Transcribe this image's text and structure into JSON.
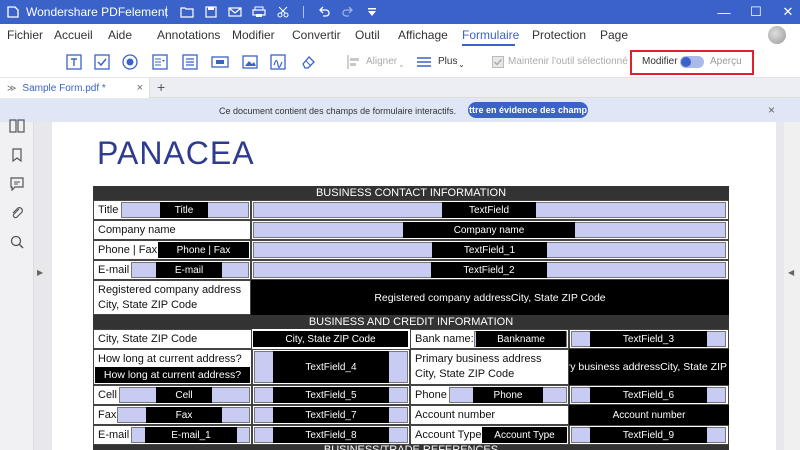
{
  "app": {
    "title": "Wondershare PDFelement"
  },
  "menu": [
    "Fichier",
    "Accueil",
    "Aide",
    "Annotations",
    "Modifier",
    "Convertir",
    "Outil",
    "Affichage",
    "Formulaire",
    "Protection",
    "Page"
  ],
  "active_menu": "Formulaire",
  "toolbar": {
    "aligner": "Aligner",
    "plus": "Plus",
    "keep_tool": "Maintenir l'outil sélectionné",
    "mode_edit": "Modifier",
    "mode_preview": "Aperçu"
  },
  "tab": {
    "name": "Sample Form.pdf *",
    "add": "+"
  },
  "notification": {
    "message": "Ce document contient des champs de formulaire interactifs.",
    "button": "ttre en évidence des champ",
    "close": "×"
  },
  "doc": {
    "brand": "PANACEA",
    "section1": "BUSINESS CONTACT INFORMATION",
    "section2": "BUSINESS AND CREDIT INFORMATION",
    "section3": "BUSINESS/TRADE REFERENCES",
    "labels": {
      "title": "Title",
      "company": "Company name",
      "phone_fax": "Phone | Fax",
      "email": "E-mail",
      "reg_addr_1": "Registered company address",
      "reg_addr_2": "City, State ZIP Code",
      "city": "City, State ZIP Code",
      "bank": "Bank name:",
      "how_long": "How long at current address?",
      "primary_1": "Primary business address",
      "primary_2": "City, State ZIP Code",
      "cell": "Cell",
      "phone": "Phone",
      "fax": "Fax",
      "account_number": "Account number",
      "email2": "E-mail",
      "account_type": "Account Type"
    },
    "fields": {
      "title": "Title",
      "textfield": "TextField",
      "company_name": "Company name",
      "phone_fax": "Phone | Fax",
      "textfield_1": "TextField_1",
      "email": "E-mail",
      "textfield_2": "TextField_2",
      "reg_addr": "Registered company addressCity, State ZIP Code",
      "city": "City, State ZIP Code",
      "bankname": "Bankname",
      "textfield_3": "TextField_3",
      "how_long": "How long at current address?",
      "textfield_4": "TextField_4",
      "primary_addr": "ry business addressCity, State ZIP",
      "cell": "Cell",
      "textfield_5": "TextField_5",
      "phone": "Phone",
      "textfield_6": "TextField_6",
      "fax": "Fax",
      "textfield_7": "TextField_7",
      "account_number": "Account number",
      "email_1": "E-mail_1",
      "textfield_8": "TextField_8",
      "account_type": "Account Type",
      "textfield_9": "TextField_9"
    }
  },
  "colors": {
    "accent": "#3a62c9",
    "highlight": "#e0202a",
    "field": "#c8cbf2",
    "brand": "#2f3b8f"
  }
}
